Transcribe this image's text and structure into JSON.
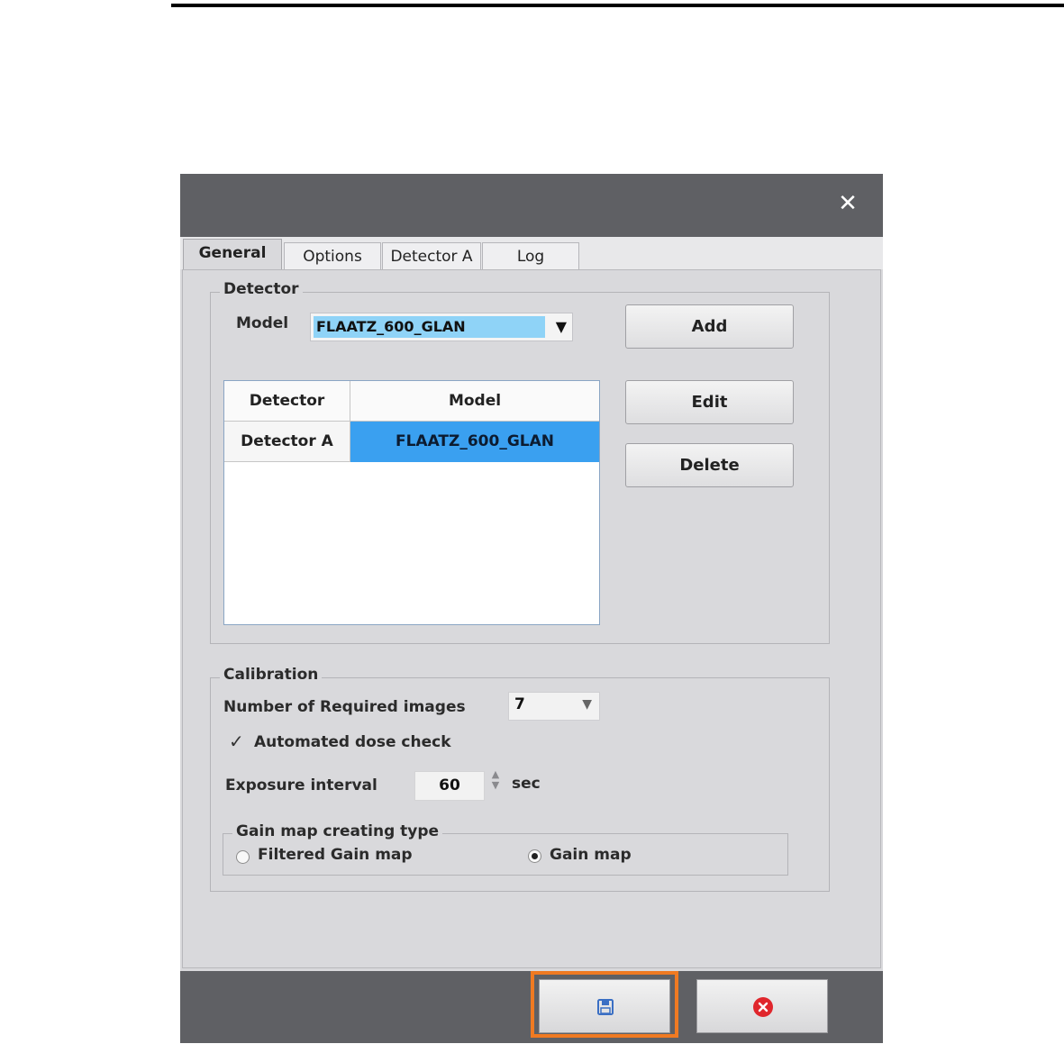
{
  "tabs": [
    {
      "label": "General",
      "active": true
    },
    {
      "label": "Options",
      "active": false
    },
    {
      "label": "Detector A",
      "active": false
    },
    {
      "label": "Log",
      "active": false
    }
  ],
  "detector_group": {
    "legend": "Detector",
    "model_label": "Model",
    "model_value": "FLAATZ_600_GLAN",
    "add_label": "Add",
    "edit_label": "Edit",
    "delete_label": "Delete",
    "table": {
      "headers": [
        "Detector",
        "Model"
      ],
      "rows": [
        [
          "Detector A",
          "FLAATZ_600_GLAN"
        ]
      ]
    }
  },
  "calibration_group": {
    "legend": "Calibration",
    "required_images_label": "Number of Required images",
    "required_images_value": "7",
    "auto_dose_label": "Automated dose check",
    "auto_dose_checked": true,
    "exposure_label": "Exposure interval",
    "exposure_value": "60",
    "exposure_unit": "sec"
  },
  "gain_group": {
    "legend": "Gain map creating type",
    "option_filtered": "Filtered Gain map",
    "option_gain": "Gain map",
    "selected": "Gain map"
  },
  "colors": {
    "titlebar": "#5f6064",
    "selection": "#3aa0f0",
    "highlight": "#f07a22",
    "cancel_icon": "#e0262c",
    "save_icon": "#3a6fc4"
  }
}
